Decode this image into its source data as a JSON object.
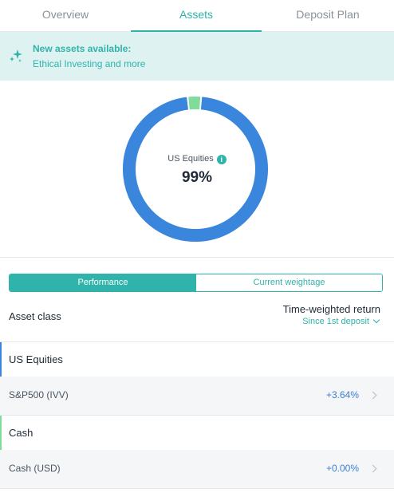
{
  "tabs": [
    {
      "label": "Overview"
    },
    {
      "label": "Assets"
    },
    {
      "label": "Deposit Plan"
    }
  ],
  "banner": {
    "title": "New assets available:",
    "subtitle": "Ethical Investing and more"
  },
  "allocation": {
    "label": "US Equities",
    "percent": "99%",
    "slices": [
      {
        "name": "US Equities",
        "share": 0.97,
        "color": "#3a86dc"
      },
      {
        "name": "Cash",
        "share": 0.03,
        "color": "#7fdc9b"
      }
    ]
  },
  "view_toggle": {
    "performance_label": "Performance",
    "weightage_label": "Current weightage"
  },
  "table_header": {
    "left": "Asset class",
    "right": "Time-weighted return",
    "period": "Since 1st deposit"
  },
  "groups": [
    {
      "name": "US Equities",
      "color": "#3a86dc",
      "items": [
        {
          "name": "S&P500 (IVV)",
          "value": "+3.64%"
        }
      ]
    },
    {
      "name": "Cash",
      "color": "#7fdc9b",
      "items": [
        {
          "name": "Cash (USD)",
          "value": "+0.00%"
        }
      ]
    }
  ],
  "colors": {
    "accent": "#2fb3aa",
    "positive": "#3a7fd4"
  }
}
